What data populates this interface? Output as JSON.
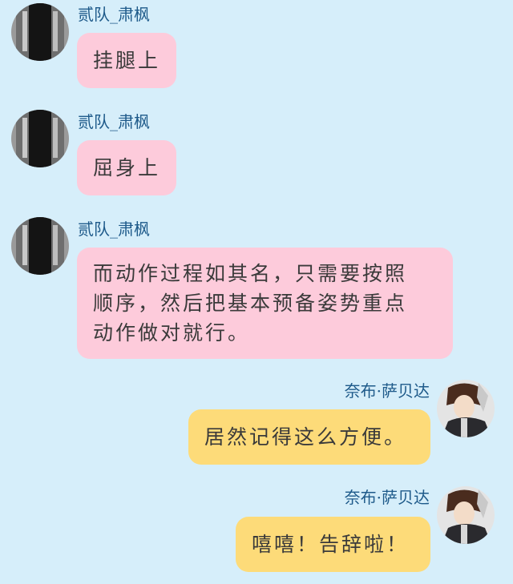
{
  "colors": {
    "background": "#d6eefa",
    "incoming_bubble": "#fdcbdb",
    "outgoing_bubble": "#fddb79",
    "sender_name": "#1e5a8a"
  },
  "messages": [
    {
      "side": "left",
      "sender": "贰队_肃枫",
      "avatar": "avatar-dark-outfit",
      "lines": [
        "挂腿上"
      ]
    },
    {
      "side": "left",
      "sender": "贰队_肃枫",
      "avatar": "avatar-dark-outfit",
      "lines": [
        "屈身上"
      ]
    },
    {
      "side": "left",
      "sender": "贰队_肃枫",
      "avatar": "avatar-dark-outfit",
      "lines": [
        "而动作过程如其名，只需要按照",
        "顺序，然后把基本预备姿势重点",
        "动作做对就行。"
      ]
    },
    {
      "side": "right",
      "sender": "奈布·萨贝达",
      "avatar": "avatar-anime-character",
      "lines": [
        "居然记得这么方便。"
      ]
    },
    {
      "side": "right",
      "sender": "奈布·萨贝达",
      "avatar": "avatar-anime-character",
      "lines": [
        "嘻嘻！告辞啦！"
      ]
    }
  ]
}
